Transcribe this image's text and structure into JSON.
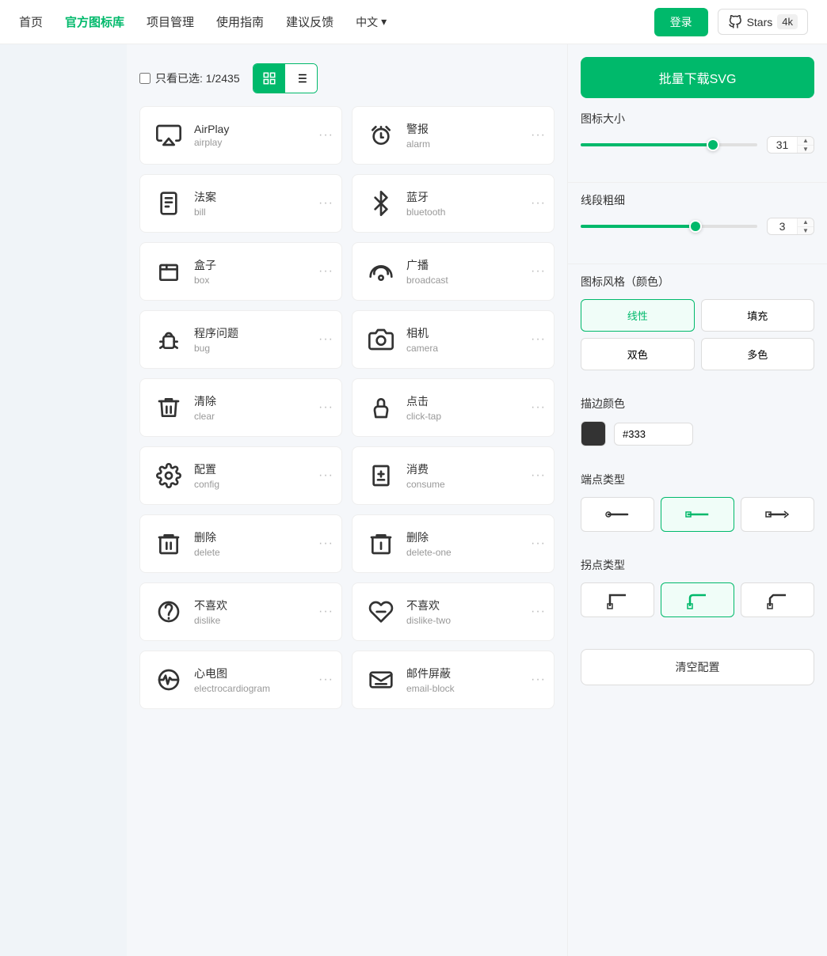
{
  "header": {
    "home": "首页",
    "icon_library": "官方图标库",
    "project_mgmt": "项目管理",
    "usage_guide": "使用指南",
    "feedback": "建议反馈",
    "language": "中文",
    "login": "登录",
    "stars_label": "Stars",
    "stars_count": "4k"
  },
  "toolbar": {
    "show_selected": "只看已选:",
    "selected_count": "1/2435"
  },
  "icons": [
    {
      "zh": "AirPlay",
      "en": "airplay"
    },
    {
      "zh": "警报",
      "en": "alarm"
    },
    {
      "zh": "法案",
      "en": "bill"
    },
    {
      "zh": "蓝牙",
      "en": "bluetooth"
    },
    {
      "zh": "盒子",
      "en": "box"
    },
    {
      "zh": "广播",
      "en": "broadcast"
    },
    {
      "zh": "程序问题",
      "en": "bug"
    },
    {
      "zh": "相机",
      "en": "camera"
    },
    {
      "zh": "清除",
      "en": "clear"
    },
    {
      "zh": "点击",
      "en": "click-tap"
    },
    {
      "zh": "配置",
      "en": "config"
    },
    {
      "zh": "消费",
      "en": "consume"
    },
    {
      "zh": "删除",
      "en": "delete"
    },
    {
      "zh": "删除",
      "en": "delete-one"
    },
    {
      "zh": "不喜欢",
      "en": "dislike"
    },
    {
      "zh": "不喜欢",
      "en": "dislike-two"
    },
    {
      "zh": "心电图",
      "en": "electrocardiogram"
    },
    {
      "zh": "邮件屏蔽",
      "en": "email-block"
    }
  ],
  "right_panel": {
    "download_btn": "批量下载SVG",
    "icon_size_label": "图标大小",
    "icon_size_value": "31",
    "stroke_width_label": "线段粗细",
    "stroke_width_value": "3",
    "style_label": "图标风格（颜色）",
    "style_options": [
      "线性",
      "填充",
      "双色",
      "多色"
    ],
    "active_style": "线性",
    "stroke_color_label": "描边颜色",
    "stroke_color_value": "#333",
    "stroke_color_hex": "#333333",
    "endpoint_type_label": "端点类型",
    "anchor_type_label": "拐点类型",
    "clear_config": "清空配置",
    "icon_size_pct": 75,
    "stroke_width_pct": 65
  }
}
